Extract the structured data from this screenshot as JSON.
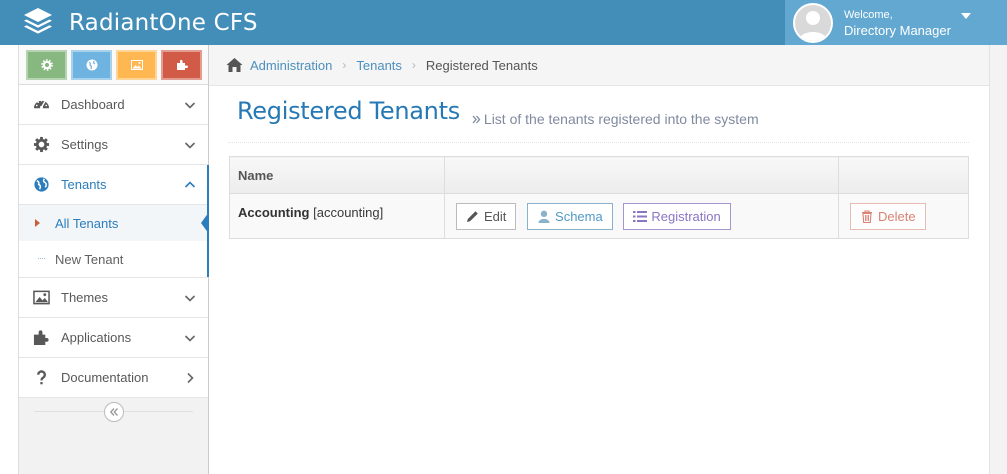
{
  "brand": {
    "name": "RadiantOne CFS"
  },
  "user": {
    "welcome": "Welcome,",
    "name": "Directory Manager"
  },
  "shortcuts": [
    {
      "icon": "gear-icon",
      "color": "#87b87f"
    },
    {
      "icon": "globe-icon",
      "color": "#6fb3e0"
    },
    {
      "icon": "picture-icon",
      "color": "#ffb752"
    },
    {
      "icon": "puzzle-icon",
      "color": "#d15b47"
    }
  ],
  "sidebar": {
    "items": [
      {
        "label": "Dashboard",
        "icon": "dashboard-icon"
      },
      {
        "label": "Settings",
        "icon": "gear-icon"
      },
      {
        "label": "Tenants",
        "icon": "globe-icon"
      },
      {
        "label": "Themes",
        "icon": "picture-icon"
      },
      {
        "label": "Applications",
        "icon": "puzzle-icon"
      },
      {
        "label": "Documentation",
        "icon": "question-icon"
      }
    ],
    "tenants_sub": [
      {
        "label": "All Tenants"
      },
      {
        "label": "New Tenant"
      }
    ]
  },
  "breadcrumb": {
    "admin": "Administration",
    "tenants": "Tenants",
    "current": "Registered Tenants"
  },
  "page": {
    "title": "Registered Tenants",
    "subtitle": "List of the tenants registered into the system"
  },
  "table": {
    "headers": [
      "Name",
      "",
      ""
    ],
    "rows": [
      {
        "name": "Accounting",
        "id": "[accounting]",
        "actions": {
          "edit": "Edit",
          "schema": "Schema",
          "registration": "Registration",
          "delete": "Delete"
        }
      }
    ]
  },
  "colors": {
    "navbar": "#438eb9",
    "accent": "#2b7dbc",
    "link": "#4c8fbd"
  }
}
